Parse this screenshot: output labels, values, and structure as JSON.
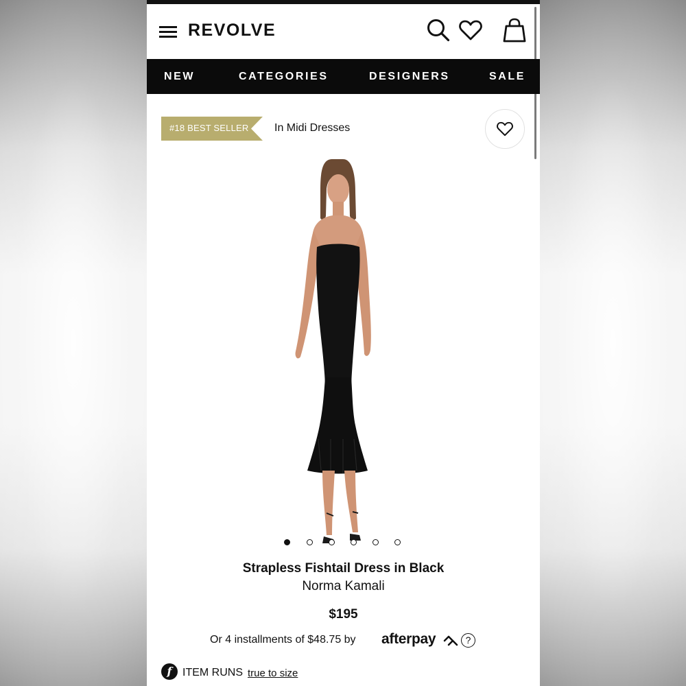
{
  "header": {
    "logo": "REVOLVE",
    "icons": [
      "menu-icon",
      "search-icon",
      "heart-icon",
      "shopping-bag-icon"
    ]
  },
  "nav": {
    "items": [
      "NEW",
      "CATEGORIES",
      "DESIGNERS",
      "SALE"
    ]
  },
  "badge": {
    "label": "#18 BEST SELLER",
    "context": "In Midi Dresses",
    "color": "#b8ad6e"
  },
  "gallery": {
    "image_count": 6,
    "active_index": 0
  },
  "product": {
    "title": "Strapless Fishtail Dress in Black",
    "designer": "Norma Kamali",
    "price": "$195",
    "installments_text": "Or 4 installments of $48.75 by",
    "afterpay_brand": "afterpay",
    "help_glyph": "?"
  },
  "fit": {
    "icon_glyph": "f",
    "label": "ITEM RUNS",
    "link": "true to size"
  }
}
